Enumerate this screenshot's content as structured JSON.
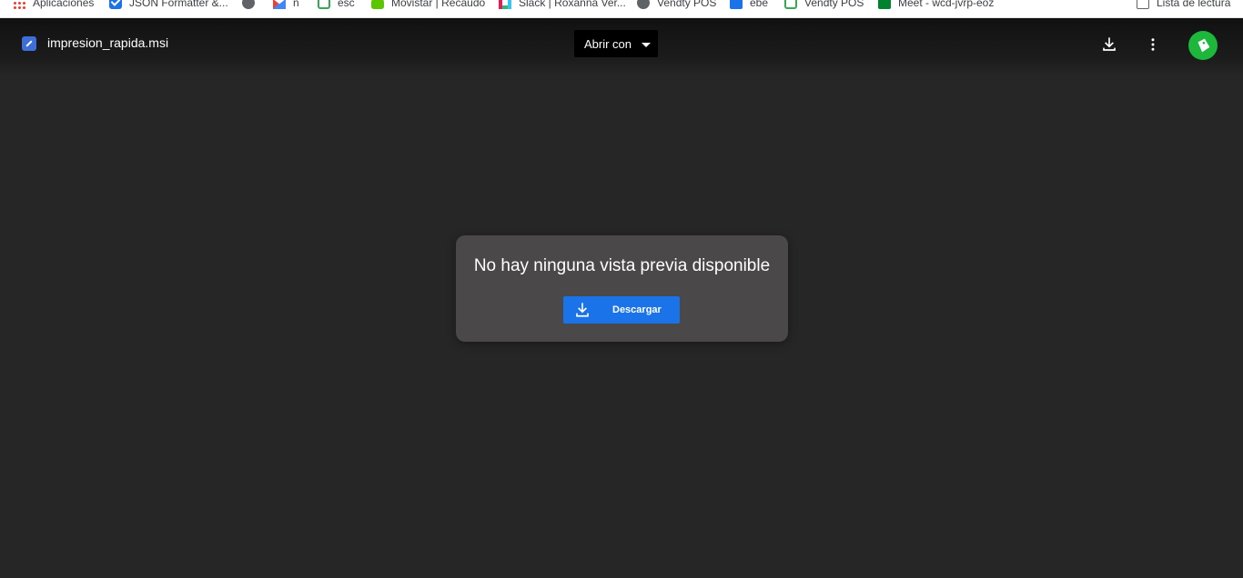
{
  "bookmarks": {
    "items": [
      {
        "label": "Aplicaciones",
        "icon": "apps-grid-icon"
      },
      {
        "label": "JSON Formatter &...",
        "icon": "json-formatter-icon"
      },
      {
        "label": "",
        "icon": "globe-icon"
      },
      {
        "label": "n",
        "icon": "gmail-icon"
      },
      {
        "label": "esc",
        "icon": "bookmark-green-icon"
      },
      {
        "label": "Movistar | Recaudo",
        "icon": "movistar-icon"
      },
      {
        "label": "Slack | Roxanna Ver...",
        "icon": "slack-icon"
      },
      {
        "label": "Vendty POS",
        "icon": "globe-icon"
      },
      {
        "label": "ebe",
        "icon": "building-icon"
      },
      {
        "label": "Vendty POS",
        "icon": "bookmark-green-icon"
      },
      {
        "label": "Meet - wcd-jvrp-eoz",
        "icon": "meet-icon"
      }
    ],
    "reading_list": "Lista de lectura"
  },
  "viewer": {
    "file_name": "impresion_rapida.msi",
    "open_with": "Abrir con"
  },
  "preview": {
    "message": "No hay ninguna vista previa disponible",
    "download_label": "Descargar"
  },
  "colors": {
    "background": "#262626",
    "card": "#4a4849",
    "accent": "#1a73e8",
    "avatar": "#1db83b"
  }
}
